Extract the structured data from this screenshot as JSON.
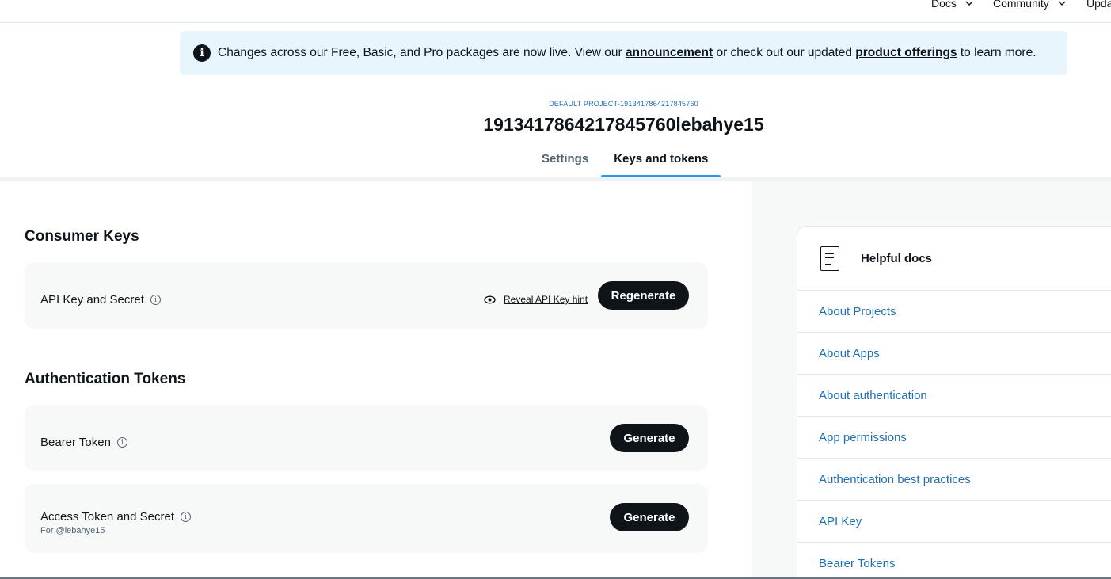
{
  "nav": {
    "items": [
      {
        "label": "Docs"
      },
      {
        "label": "Community"
      },
      {
        "label": "Upda"
      }
    ]
  },
  "banner": {
    "text_before": "Changes across our Free, Basic, and Pro packages are now live. View our ",
    "link1": "announcement",
    "text_middle": " or check out our updated ",
    "link2": "product offerings",
    "text_after": " to learn more."
  },
  "project": {
    "label": "DEFAULT PROJECT-1913417864217845760",
    "title": "1913417864217845760lebahye15"
  },
  "tabs": [
    {
      "label": "Settings",
      "active": false
    },
    {
      "label": "Keys and tokens",
      "active": true
    }
  ],
  "consumer_keys": {
    "title": "Consumer Keys",
    "api_key": {
      "label": "API Key and Secret",
      "reveal": "Reveal API Key hint",
      "button": "Regenerate"
    }
  },
  "auth_tokens": {
    "title": "Authentication Tokens",
    "bearer": {
      "label": "Bearer Token",
      "button": "Generate"
    },
    "access": {
      "label": "Access Token and Secret",
      "sub": "For @lebahye15",
      "button": "Generate"
    }
  },
  "helpful_docs": {
    "title": "Helpful docs",
    "links": [
      {
        "label": "About Projects"
      },
      {
        "label": "About Apps"
      },
      {
        "label": "About authentication"
      },
      {
        "label": "App permissions"
      },
      {
        "label": "Authentication best practices"
      },
      {
        "label": "API Key"
      },
      {
        "label": "Bearer Tokens"
      }
    ]
  },
  "colors": {
    "accent": "#1d9bf0",
    "link": "#1d6fb8",
    "button": "#0f1419",
    "banner_bg": "#e8f5fd"
  }
}
